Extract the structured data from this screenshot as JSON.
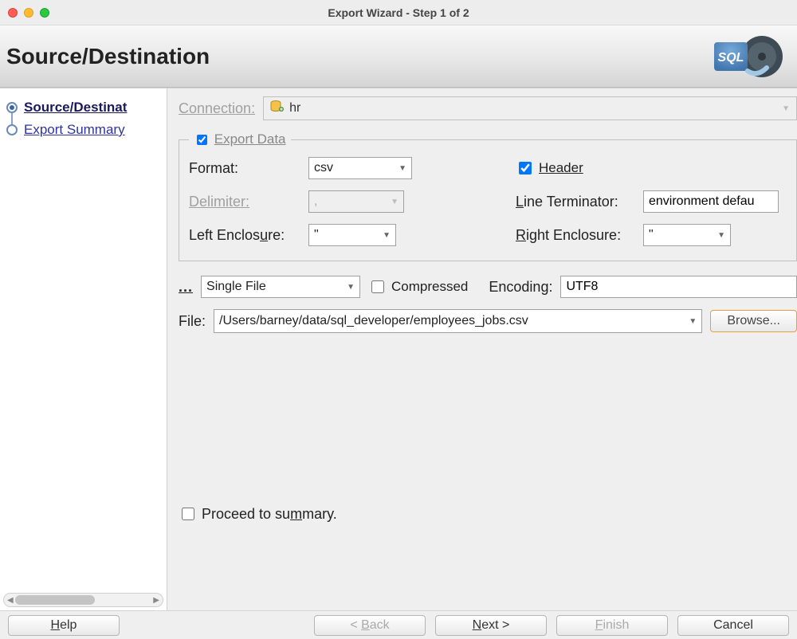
{
  "window": {
    "title": "Export Wizard - Step 1 of 2"
  },
  "page": {
    "heading": "Source/Destination"
  },
  "sidebar": {
    "steps": [
      {
        "label": "Source/Destinat",
        "current": true
      },
      {
        "label": "Export Summary",
        "current": false
      }
    ]
  },
  "form": {
    "connection_label": "Connection:",
    "connection_value": "hr",
    "export_data_label": "Export Data",
    "export_data_checked": true,
    "format_label": "Format:",
    "format_value": "csv",
    "header_label": "Header",
    "header_checked": true,
    "delimiter_label": "Delimiter:",
    "delimiter_value": ",",
    "line_terminator_label": "Line Terminator:",
    "line_terminator_value": "environment defau",
    "left_enclosure_label": "Left Enclosure:",
    "left_enclosure_value": "\"",
    "right_enclosure_label": "Right Enclosure:",
    "right_enclosure_value": "\"",
    "save_as_label": "...",
    "save_as_value": "Single File",
    "compressed_label": "Compressed",
    "compressed_checked": false,
    "encoding_label": "Encoding:",
    "encoding_value": "UTF8",
    "file_label": "File:",
    "file_value": "/Users/barney/data/sql_developer/employees_jobs.csv",
    "browse_label": "Browse...",
    "proceed_label": "Proceed to summary.",
    "proceed_checked": false
  },
  "footer": {
    "help": "Help",
    "back": "< Back",
    "next": "Next >",
    "finish": "Finish",
    "cancel": "Cancel"
  }
}
